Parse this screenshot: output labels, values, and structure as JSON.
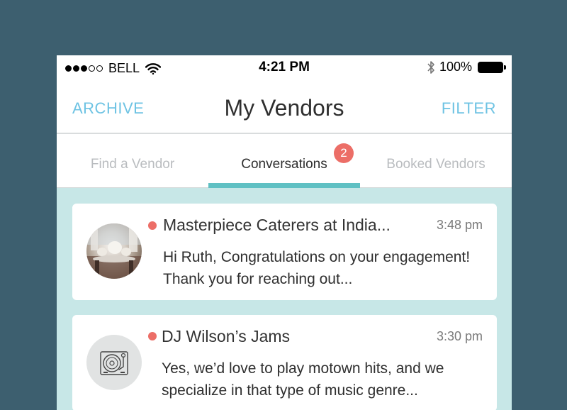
{
  "status_bar": {
    "carrier": "BELL",
    "signal_dots_filled": 3,
    "signal_dots_total": 5,
    "time": "4:21 PM",
    "battery": "100%",
    "icons": [
      "wifi-icon",
      "bluetooth-icon",
      "battery-icon"
    ]
  },
  "nav": {
    "left_button": "ARCHIVE",
    "title": "My Vendors",
    "right_button": "FILTER"
  },
  "tabs": [
    {
      "label": "Find a Vendor",
      "active": false
    },
    {
      "label": "Conversations",
      "active": true,
      "badge": "2"
    },
    {
      "label": "Booked Vendors",
      "active": false
    }
  ],
  "conversations": [
    {
      "vendor": "Masterpiece Caterers at India...",
      "time": "3:48 pm",
      "message": "Hi Ruth, Congratulations on your engagement! Thank you for reaching out...",
      "unread": true,
      "avatar": "venue-photo"
    },
    {
      "vendor": "DJ Wilson’s Jams",
      "time": "3:30 pm",
      "message": "Yes, we’d love to play motown hits, and we specialize in that type of music genre...",
      "unread": true,
      "avatar": "turntable-icon"
    }
  ],
  "colors": {
    "background": "#3d5f6f",
    "accent_link": "#6ec3e3",
    "tab_underline": "#5fc0c3",
    "badge": "#ec6e67",
    "list_background": "#c7e7e7"
  }
}
